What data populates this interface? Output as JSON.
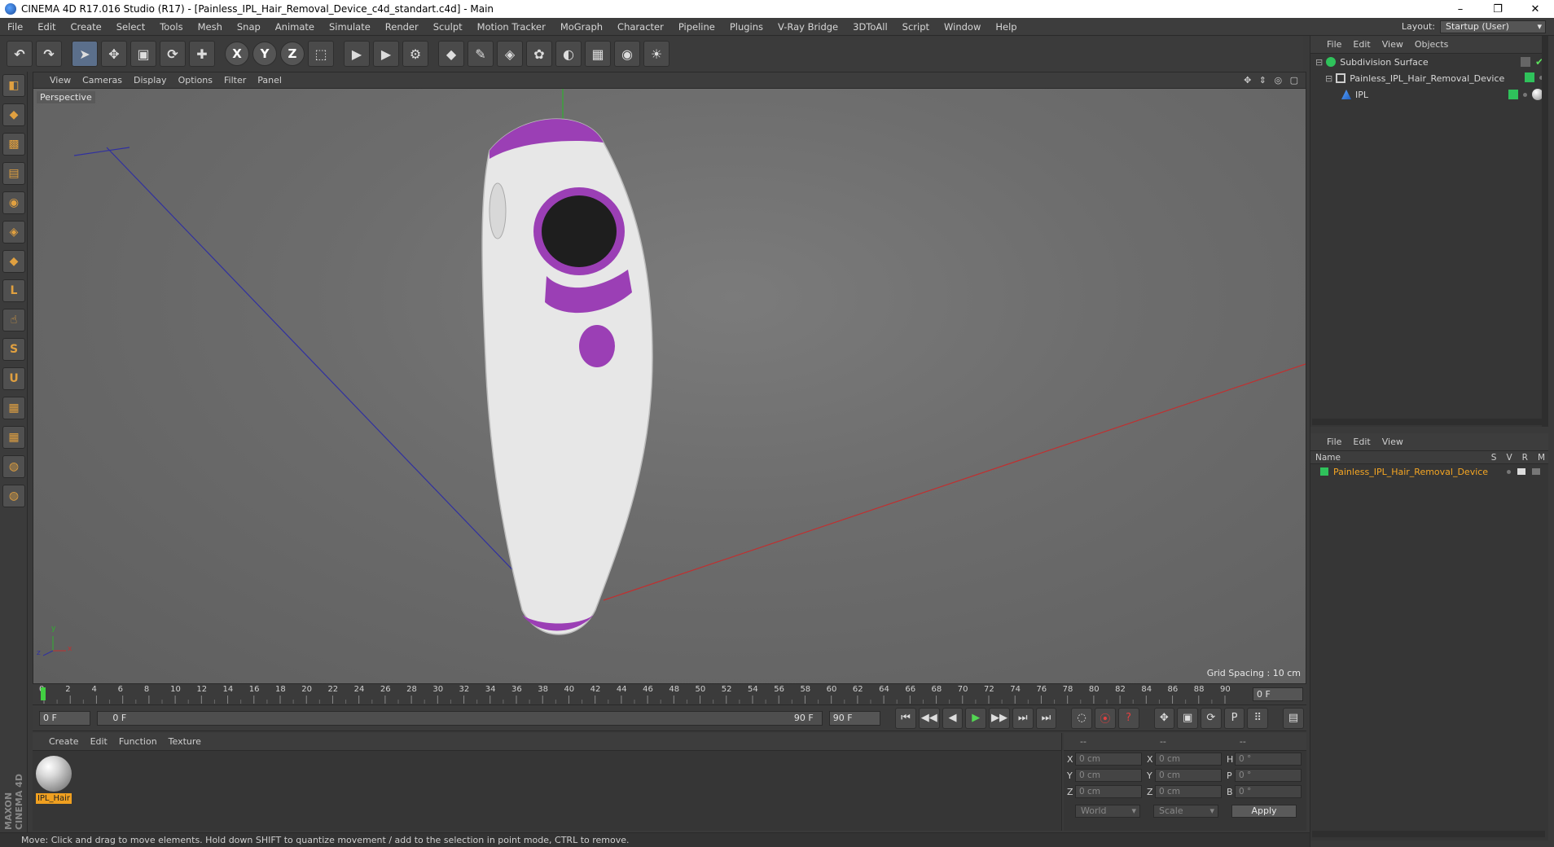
{
  "window": {
    "title": "CINEMA 4D R17.016 Studio (R17) - [Painless_IPL_Hair_Removal_Device_c4d_standart.c4d] - Main",
    "minimize": "–",
    "maximize": "❐",
    "close": "✕"
  },
  "menubar": {
    "items": [
      "File",
      "Edit",
      "Create",
      "Select",
      "Tools",
      "Mesh",
      "Snap",
      "Animate",
      "Simulate",
      "Render",
      "Sculpt",
      "Motion Tracker",
      "MoGraph",
      "Character",
      "Pipeline",
      "Plugins",
      "V-Ray Bridge",
      "3DToAll",
      "Script",
      "Window",
      "Help"
    ],
    "layout_label": "Layout:",
    "layout_value": "Startup (User)"
  },
  "toolbar": {
    "undo": "↶",
    "redo": "↷",
    "select": "➤",
    "move": "✥",
    "scale": "▣",
    "rotate": "⟳",
    "live": "✚",
    "x": "X",
    "y": "Y",
    "z": "Z",
    "coord": "⬚",
    "render_view": "▶",
    "render": "▶",
    "render_settings": "⚙",
    "cube": "◆",
    "spline": "✎",
    "nurbs": "◈",
    "array": "✿",
    "deformer": "◐",
    "floor": "▦",
    "camera": "◉",
    "light": "☀"
  },
  "lefttools": [
    "◧",
    "◆",
    "▩",
    "▤",
    "◉",
    "◈",
    "◆",
    "L",
    "☝",
    "S",
    "U",
    "▦",
    "▦",
    "◍",
    "◍"
  ],
  "maxon_text": "MAXON CINEMA 4D",
  "viewport": {
    "menu": [
      "View",
      "Cameras",
      "Display",
      "Options",
      "Filter",
      "Panel"
    ],
    "nav_icons": "✥ ⇕ ◎ ▢",
    "label": "Perspective",
    "grid_spacing": "Grid Spacing : 10 cm",
    "axis_x": "x",
    "axis_y": "y",
    "axis_z": "z"
  },
  "timeline": {
    "ticks": [
      "0",
      "2",
      "4",
      "6",
      "8",
      "10",
      "12",
      "14",
      "16",
      "18",
      "20",
      "22",
      "24",
      "26",
      "28",
      "30",
      "32",
      "34",
      "36",
      "38",
      "40",
      "42",
      "44",
      "46",
      "48",
      "50",
      "52",
      "54",
      "56",
      "58",
      "60",
      "62",
      "64",
      "66",
      "68",
      "70",
      "72",
      "74",
      "76",
      "78",
      "80",
      "82",
      "84",
      "86",
      "88",
      "90"
    ],
    "current_frame": "0 F"
  },
  "transport": {
    "start_field": "0 F",
    "range_start": "0 F",
    "range_end": "90 F",
    "end_field": "90 F",
    "buttons": [
      "⏮",
      "◀◀",
      "◀",
      "▶",
      "▶▶",
      "⏭",
      "⏭"
    ],
    "keys": [
      "◌",
      "⦿",
      "?",
      "✥",
      "▣",
      "⟳",
      "P",
      "⠿",
      "▤"
    ]
  },
  "material_panel": {
    "menu": [
      "Create",
      "Edit",
      "Function",
      "Texture"
    ],
    "material_name": "IPL_Hair"
  },
  "coord_panel": {
    "head": [
      "--",
      "--",
      "--"
    ],
    "rows": [
      {
        "a1": "X",
        "v1": "0 cm",
        "a2": "X",
        "v2": "0 cm",
        "a3": "H",
        "v3": "0 °"
      },
      {
        "a1": "Y",
        "v1": "0 cm",
        "a2": "Y",
        "v2": "0 cm",
        "a3": "P",
        "v3": "0 °"
      },
      {
        "a1": "Z",
        "v1": "0 cm",
        "a2": "Z",
        "v2": "0 cm",
        "a3": "B",
        "v3": "0 °"
      }
    ],
    "world": "World",
    "scale": "Scale",
    "apply": "Apply"
  },
  "status": "Move: Click and drag to move elements. Hold down SHIFT to quantize movement / add to the selection in point mode, CTRL to remove.",
  "object_manager": {
    "menu": [
      "File",
      "Edit",
      "View",
      "Objects"
    ],
    "objects": [
      {
        "name": "Subdivision Surface",
        "indent": 0
      },
      {
        "name": "Painless_IPL_Hair_Removal_Device",
        "indent": 1
      },
      {
        "name": "IPL",
        "indent": 2
      }
    ]
  },
  "attribute_manager": {
    "menu": [
      "File",
      "Edit",
      "View"
    ],
    "name_col": "Name",
    "cols": [
      "S",
      "V",
      "R",
      "M"
    ],
    "item": "Painless_IPL_Hair_Removal_Device"
  },
  "colors": {
    "accent_orange": "#f5a623",
    "tag_green": "#2fc25b",
    "device_purple": "#9b3fb5",
    "axis_red": "#c03030",
    "axis_blue": "#3030a0",
    "axis_green": "#30b030"
  }
}
